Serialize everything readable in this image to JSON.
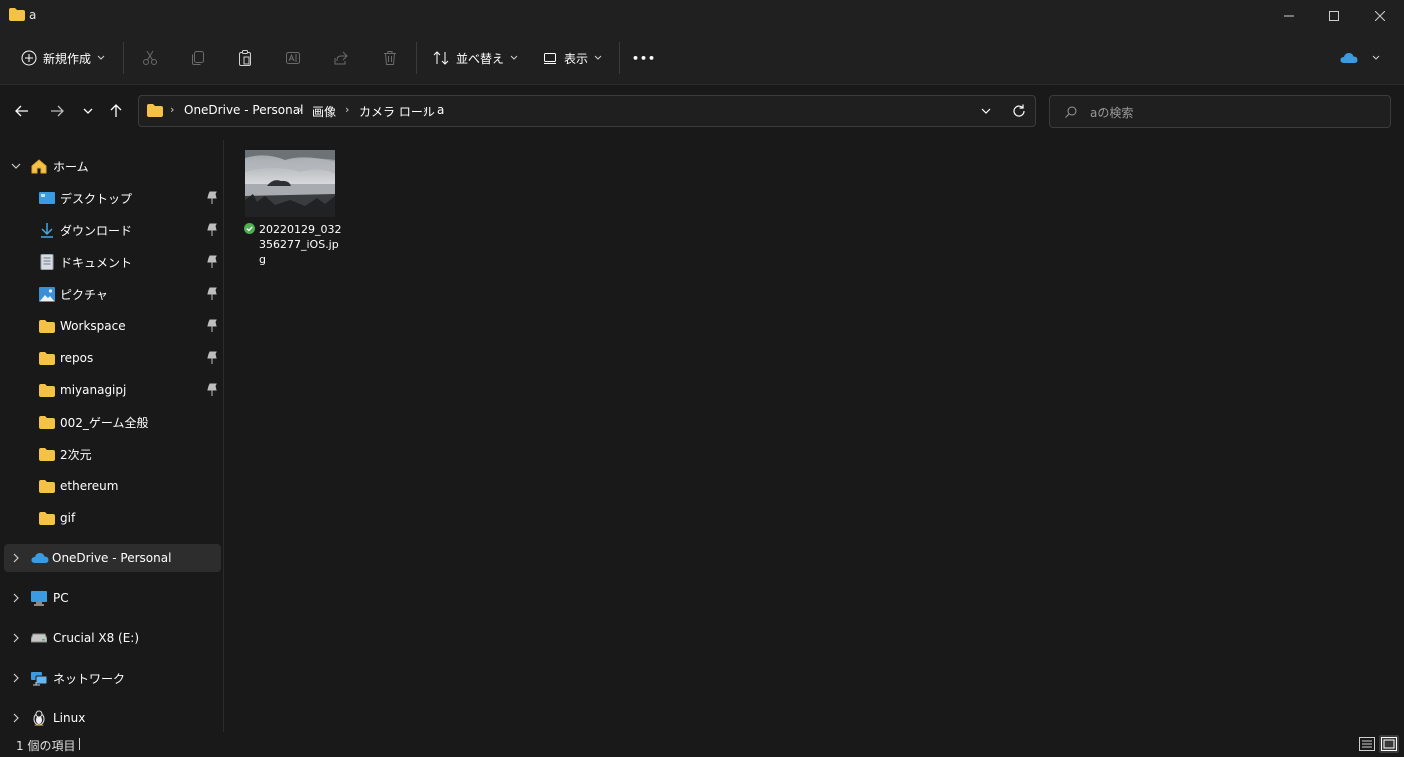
{
  "window": {
    "title": "a"
  },
  "toolbar": {
    "new_label": "新規作成",
    "sort_label": "並べ替え",
    "view_label": "表示",
    "more_label": "•••"
  },
  "address": {
    "crumbs": [
      "OneDrive - Personal",
      "画像",
      "カメラ ロール",
      "a"
    ]
  },
  "search": {
    "placeholder": "aの検索"
  },
  "sidebar": {
    "home": "ホーム",
    "items": [
      {
        "label": "デスクトップ",
        "icon": "desktop-icon",
        "pinned": true
      },
      {
        "label": "ダウンロード",
        "icon": "download-icon",
        "pinned": true
      },
      {
        "label": "ドキュメント",
        "icon": "document-icon",
        "pinned": true
      },
      {
        "label": "ピクチャ",
        "icon": "pictures-icon",
        "pinned": true
      },
      {
        "label": "Workspace",
        "icon": "folder-icon",
        "pinned": true
      },
      {
        "label": "repos",
        "icon": "folder-icon",
        "pinned": true
      },
      {
        "label": "miyanagipj",
        "icon": "folder-icon",
        "pinned": true
      },
      {
        "label": "002_ゲーム全般",
        "icon": "folder-icon",
        "pinned": false
      },
      {
        "label": "2次元",
        "icon": "folder-icon",
        "pinned": false
      },
      {
        "label": "ethereum",
        "icon": "folder-icon",
        "pinned": false
      },
      {
        "label": "gif",
        "icon": "folder-icon",
        "pinned": false
      }
    ],
    "onedrive": "OneDrive - Personal",
    "pc": "PC",
    "drive": "Crucial X8 (E:)",
    "network": "ネットワーク",
    "linux": "Linux"
  },
  "files": [
    {
      "name": "20220129_032356277_iOS.jpg",
      "synced": true
    }
  ],
  "status": {
    "count_text": "1 個の項目"
  },
  "colors": {
    "background": "#191919",
    "chrome": "#202020",
    "folder": "#f4c244",
    "onedrive": "#3a9be0",
    "selected": "#2d2d2d",
    "sync_ok": "#4caf50"
  }
}
